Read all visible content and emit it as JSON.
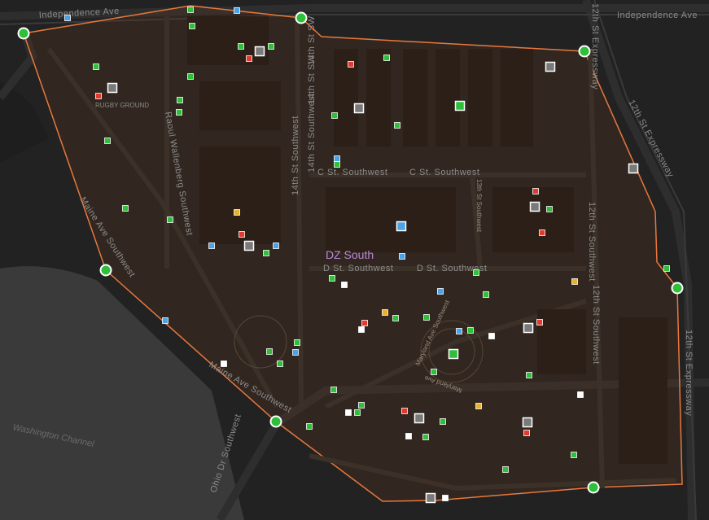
{
  "map": {
    "zone_name": "DZ South",
    "zone_color": "#e8783c",
    "landmark": "RUGBY GROUND",
    "water_label": "Washington Channel",
    "streets": {
      "independence_ave_left": "Independence Ave",
      "independence_ave_right": "Independence Ave",
      "twelfth_expwy_top": "12th St Expressway",
      "twelfth_expwy_mid": "12th St Expressway",
      "twelfth_expwy_right": "12th St Expressway",
      "fourteenth_sw_a": "14th St Southwest",
      "fourteenth_sw_b": "14th St SW",
      "fourteenth_sw_c": "14th St Southwest",
      "fourteenth_sw_d": "14th St SW",
      "raoul_wallenberg": "Raoul Wallenberg Southwest",
      "c_st_1": "C St. Southwest",
      "c_st_2": "C St. Southwest",
      "d_st_1": "D St. Southwest",
      "d_st_2": "D St. Southwest",
      "thirteenth_sw": "13th St Southwest",
      "twelfth_sw_1": "12th St Southwest",
      "twelfth_sw_2": "12th St Southwest",
      "maine_ave_1": "Maine Ave Southwest",
      "maine_ave_2": "Maine Ave Southwest",
      "maryland_ave_1": "Maryland Ave Southwest",
      "maryland_ave_2": "Maryland Ave",
      "ohio_dr": "Ohio Dr Southwest"
    },
    "legend_colors": {
      "green": "#2fbf3a",
      "red": "#e33a2e",
      "blue": "#4aa3e8",
      "yellow": "#e8b22e",
      "white": "#ffffff",
      "gray": "#9a9a9a",
      "vertex": "#2fbf3a"
    }
  }
}
